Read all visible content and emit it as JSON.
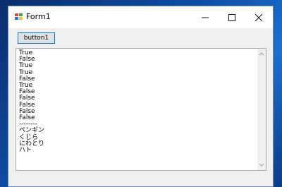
{
  "window": {
    "title": "Form1",
    "controls": {
      "minimize_icon": "minimize-icon",
      "maximize_icon": "maximize-icon",
      "close_icon": "close-icon"
    }
  },
  "toolbar": {
    "button1_label": "button1"
  },
  "output": {
    "lines": [
      "True",
      "False",
      "True",
      "True",
      "False",
      "True",
      "False",
      "False",
      "False",
      "False",
      "False",
      "--------",
      "ペンギン",
      "くじら",
      "にわとり",
      "ハト"
    ]
  },
  "colors": {
    "accent": "#0078d7",
    "desktop": "#1b6fd0"
  }
}
